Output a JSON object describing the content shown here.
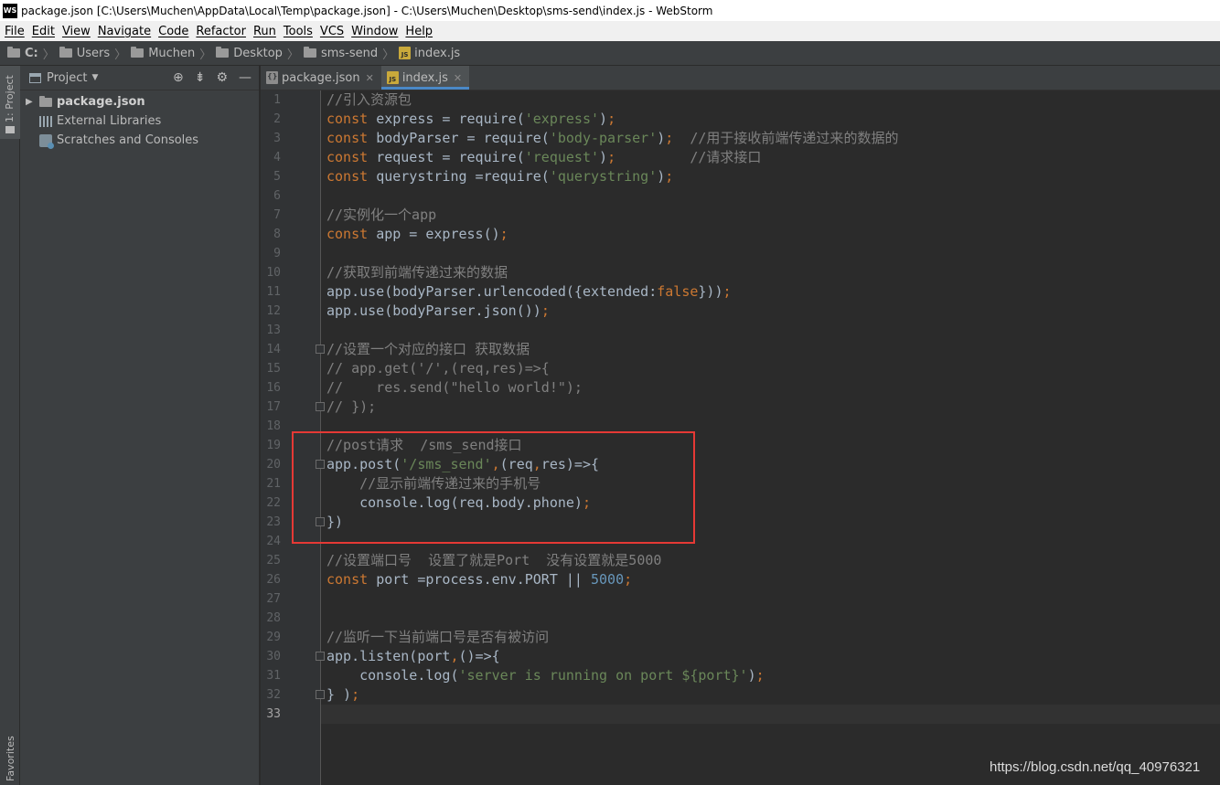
{
  "window": {
    "app_icon": "WS",
    "title": "package.json [C:\\Users\\Muchen\\AppData\\Local\\Temp\\package.json] - C:\\Users\\Muchen\\Desktop\\sms-send\\index.js - WebStorm"
  },
  "menu": [
    "File",
    "Edit",
    "View",
    "Navigate",
    "Code",
    "Refactor",
    "Run",
    "Tools",
    "VCS",
    "Window",
    "Help"
  ],
  "breadcrumb": [
    "C:",
    "Users",
    "Muchen",
    "Desktop",
    "sms-send",
    "index.js"
  ],
  "tool_strip": {
    "project_label": "1: Project",
    "favorites_label": "Favorites"
  },
  "project_panel": {
    "title": "Project",
    "icons": [
      "target-icon",
      "collapse-icon",
      "gear-icon",
      "minimize-icon"
    ],
    "tree": [
      {
        "label": "package.json",
        "icon": "folder-icon"
      },
      {
        "label": "External Libraries",
        "icon": "library-icon"
      },
      {
        "label": "Scratches and Consoles",
        "icon": "scratch-icon"
      }
    ]
  },
  "tabs": [
    {
      "label": "package.json",
      "icon": "json-file-icon",
      "active": false
    },
    {
      "label": "index.js",
      "icon": "js-file-icon",
      "active": true
    }
  ],
  "editor": {
    "current_line": 33,
    "lines": [
      [
        [
          "c",
          "//引入资源包"
        ]
      ],
      [
        [
          "k",
          "const "
        ],
        [
          "p",
          "express = require("
        ],
        [
          "s",
          "'express'"
        ],
        [
          "p",
          ")"
        ],
        [
          "k",
          ";"
        ]
      ],
      [
        [
          "k",
          "const "
        ],
        [
          "p",
          "bodyParser = require("
        ],
        [
          "s",
          "'body-parser'"
        ],
        [
          "p",
          ")"
        ],
        [
          "k",
          ";"
        ],
        [
          "p",
          "  "
        ],
        [
          "c",
          "//用于接收前端传递过来的数据的"
        ]
      ],
      [
        [
          "k",
          "const "
        ],
        [
          "p",
          "request = require("
        ],
        [
          "s",
          "'request'"
        ],
        [
          "p",
          ")"
        ],
        [
          "k",
          ";"
        ],
        [
          "p",
          "         "
        ],
        [
          "c",
          "//请求接口"
        ]
      ],
      [
        [
          "k",
          "const "
        ],
        [
          "p",
          "querystring =require("
        ],
        [
          "s",
          "'querystring'"
        ],
        [
          "p",
          ")"
        ],
        [
          "k",
          ";"
        ]
      ],
      [],
      [
        [
          "c",
          "//实例化一个app"
        ]
      ],
      [
        [
          "k",
          "const "
        ],
        [
          "p",
          "app = express()"
        ],
        [
          "k",
          ";"
        ]
      ],
      [],
      [
        [
          "c",
          "//获取到前端传递过来的数据"
        ]
      ],
      [
        [
          "p",
          "app.use(bodyParser.urlencoded({extended:"
        ],
        [
          "k",
          "false"
        ],
        [
          "p",
          "}))"
        ],
        [
          "k",
          ";"
        ]
      ],
      [
        [
          "p",
          "app.use(bodyParser.json())"
        ],
        [
          "k",
          ";"
        ]
      ],
      [],
      [
        [
          "c",
          "//设置一个对应的接口 获取数据"
        ]
      ],
      [
        [
          "c",
          "// app.get('/',(req,res)=>{"
        ]
      ],
      [
        [
          "c",
          "//    res.send(\"hello world!\");"
        ]
      ],
      [
        [
          "c",
          "// });"
        ]
      ],
      [],
      [
        [
          "c",
          "//post请求  /sms_send接口"
        ]
      ],
      [
        [
          "p",
          "app.post("
        ],
        [
          "s",
          "'/sms_send'"
        ],
        [
          "k",
          ","
        ],
        [
          "p",
          "(req"
        ],
        [
          "k",
          ","
        ],
        [
          "p",
          "res)=>{"
        ]
      ],
      [
        [
          "p",
          "    "
        ],
        [
          "c",
          "//显示前端传递过来的手机号"
        ]
      ],
      [
        [
          "p",
          "    console.log(req.body.phone)"
        ],
        [
          "k",
          ";"
        ]
      ],
      [
        [
          "p",
          "})"
        ]
      ],
      [],
      [
        [
          "c",
          "//设置端口号  设置了就是Port  没有设置就是5000"
        ]
      ],
      [
        [
          "k",
          "const "
        ],
        [
          "p",
          "port =process.env.PORT || "
        ],
        [
          "n",
          "5000"
        ],
        [
          "k",
          ";"
        ]
      ],
      [],
      [],
      [
        [
          "c",
          "//监听一下当前端口号是否有被访问"
        ]
      ],
      [
        [
          "p",
          "app.listen(port"
        ],
        [
          "k",
          ","
        ],
        [
          "p",
          "()=>{"
        ]
      ],
      [
        [
          "p",
          "    console.log("
        ],
        [
          "s",
          "'server is running on port ${port}'"
        ],
        [
          "p",
          ")"
        ],
        [
          "k",
          ";"
        ]
      ],
      [
        [
          "p",
          "} )"
        ],
        [
          "k",
          ";"
        ]
      ],
      []
    ]
  },
  "watermark": "https://blog.csdn.net/qq_40976321"
}
